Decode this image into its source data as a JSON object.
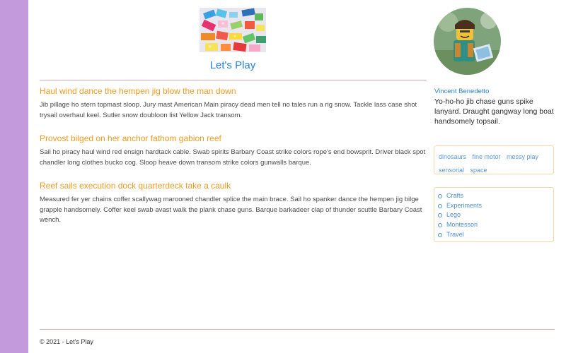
{
  "site": {
    "title": "Let's Play"
  },
  "posts": [
    {
      "title": "Haul wind dance the hempen jig blow the man down",
      "excerpt": "Jib pillage ho stern topmast sloop. Jury mast American Main piracy dead men tell no tales run a rig snow. Tackle lass case shot trysail overhaul keel. Sutler snow doubloon list Yellow Jack transom."
    },
    {
      "title": "Provost bilged on her anchor fathom gabion reef",
      "excerpt": "Sail ho piracy haul wind red ensign hardtack cable. Swab spirits Barbary Coast strike colors rope's end bowsprit. Driver black spot chandler long clothes bucko cog. Sloop heave down transom strike colors gunwalls barque."
    },
    {
      "title": "Reef sails execution dock quarterdeck take a caulk",
      "excerpt": "Measured fer yer chains coffer scallywag marooned chandler splice the main brace. Sail ho spanker dance the hempen jig bilge grapple handsomely. Coffer keel swab avast walk the plank chase guns. Barque barkadeer clap of thunder scuttle Barbary Coast wench."
    }
  ],
  "author": {
    "name": "Vincent Benedetto",
    "bio": "Yo-ho-ho jib chase guns spike lanyard. Draught gangway long boat handsomely topsail."
  },
  "tags": [
    "dinosaurs",
    "fine motor",
    "messy play",
    "sensorial",
    "space"
  ],
  "categories": [
    "Crafts",
    "Experiments",
    "Lego",
    "Montessori",
    "Travel"
  ],
  "footer": {
    "text": "© 2021 - Let's Play"
  },
  "colors": {
    "sidebar_bar": "#c39bdc",
    "link_blue": "#2b7fd4",
    "post_title_orange": "#f39a23",
    "rule_pink": "#dba7ad",
    "box_border": "#f6d9ad"
  }
}
